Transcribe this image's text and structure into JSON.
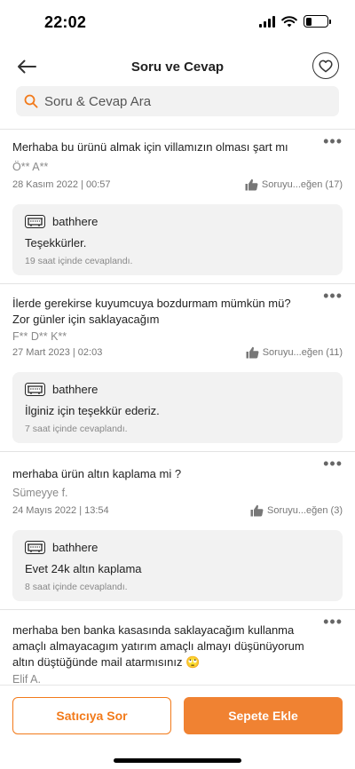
{
  "status_bar": {
    "time": "22:02",
    "battery_level": 0.3
  },
  "header": {
    "title": "Soru ve Cevap",
    "back_icon": "arrow-left-icon",
    "favorite_icon": "heart-icon"
  },
  "search": {
    "placeholder": "Soru & Cevap Ara",
    "value": "",
    "icon": "search-icon"
  },
  "accent_color": "#f27a1a",
  "questions": [
    {
      "text": "Merhaba bu ürünü almak için villamızın olması şart mı",
      "author": "Ö** A**",
      "date": "28 Kasım 2022 | 00:57",
      "likes_label": "Soruyu...eğen (17)",
      "answer": {
        "seller": "bathhere",
        "text": "Teşekkürler.",
        "time": "19 saat içinde cevaplandı."
      }
    },
    {
      "text": "İlerde gerekirse kuyumcuya bozdurmam mümkün mü? Zor günler için saklayacağım",
      "author": "F** D** K**",
      "date": "27 Mart 2023 | 02:03",
      "likes_label": "Soruyu...eğen (11)",
      "answer": {
        "seller": "bathhere",
        "text": "İlginiz için teşekkür ederiz.",
        "time": "7 saat içinde cevaplandı."
      }
    },
    {
      "text": "merhaba ürün altın kaplama mi ?",
      "author": "Sümeyye f.",
      "date": "24 Mayıs 2022 | 13:54",
      "likes_label": "Soruyu...eğen (3)",
      "answer": {
        "seller": "bathhere",
        "text": "Evet 24k altın kaplama",
        "time": "8 saat içinde cevaplandı."
      }
    },
    {
      "text": "merhaba ben banka kasasında saklayacağım  kullanma amaçlı almayacagım yatırım amaçlı almayı düşünüyorum altın düştüğünde mail atarmısınız 🙄",
      "author": "Elif A."
    }
  ],
  "more_icon_label": "•••",
  "bottom_bar": {
    "ask_seller_label": "Satıcıya Sor",
    "add_to_cart_label": "Sepete Ekle"
  }
}
